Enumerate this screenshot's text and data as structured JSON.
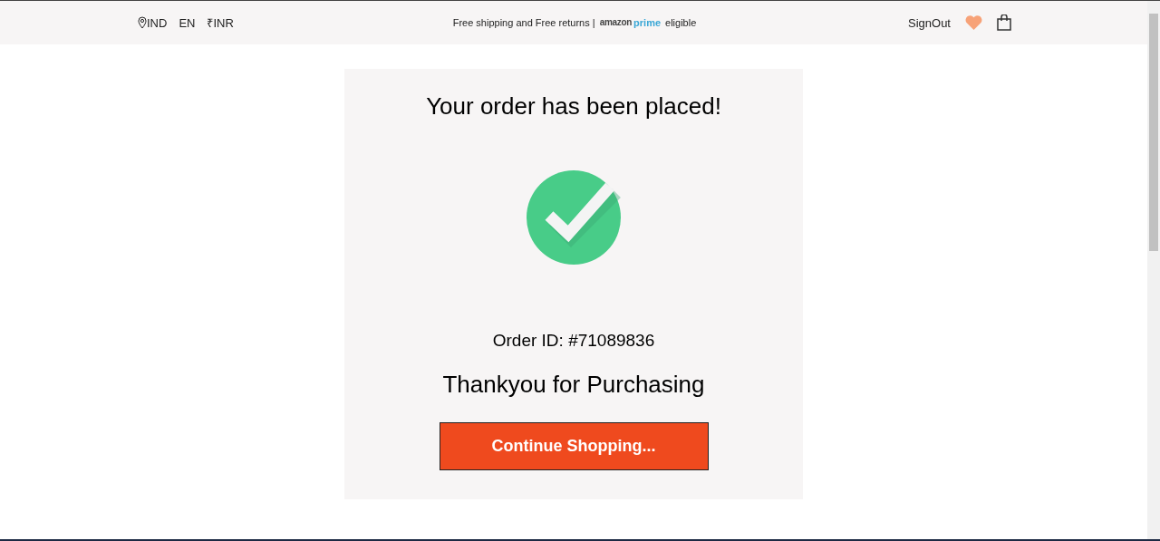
{
  "header": {
    "locale": {
      "country": "IND",
      "language": "EN",
      "currency": "₹INR"
    },
    "promo": {
      "text": "Free shipping and Free returns |",
      "brand": "amazon",
      "brand_accent": "prime",
      "suffix": "eligible"
    },
    "account": {
      "sign_out": "SignOut"
    }
  },
  "confirmation": {
    "title": "Your order has been placed!",
    "order_id": "Order ID: #71089836",
    "thanks": "Thankyou for Purchasing",
    "button": "Continue Shopping..."
  }
}
